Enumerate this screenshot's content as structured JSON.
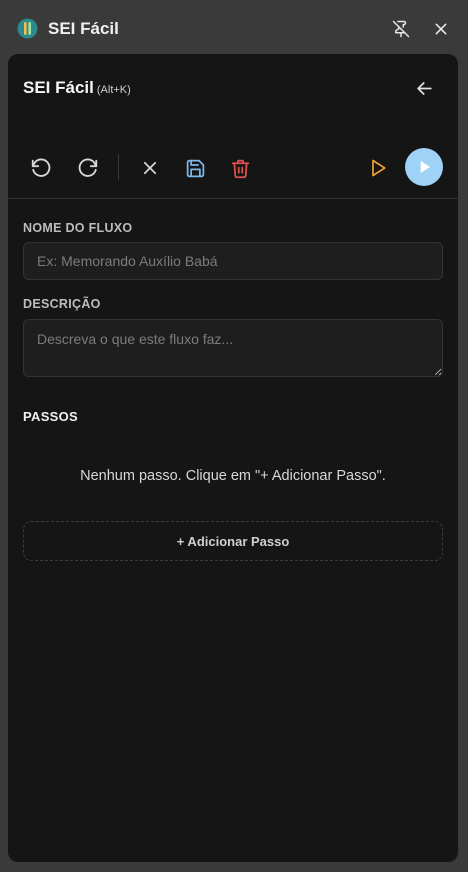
{
  "window": {
    "title": "SEI Fácil"
  },
  "panel": {
    "title": "SEI Fácil",
    "hotkey": "(Alt+K)"
  },
  "toolbar": {
    "accent_save": "#7db8e8",
    "accent_delete": "#e05252",
    "accent_test": "#f0a030",
    "accent_run": "#9fd2f7"
  },
  "form": {
    "name_label": "NOME DO FLUXO",
    "name_placeholder": "Ex: Memorando Auxílio Babá",
    "name_value": "",
    "desc_label": "DESCRIÇÃO",
    "desc_placeholder": "Descreva o que este fluxo faz...",
    "desc_value": ""
  },
  "steps": {
    "label": "PASSOS",
    "empty_message": "Nenhum passo. Clique em \"+ Adicionar Passo\".",
    "add_button": "+ Adicionar Passo"
  }
}
